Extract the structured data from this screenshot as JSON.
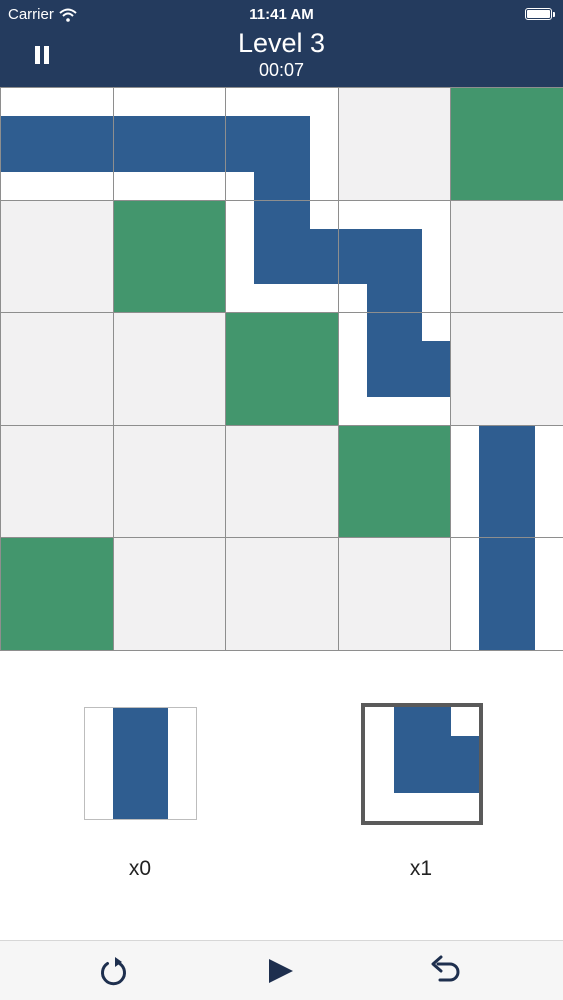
{
  "status_bar": {
    "carrier": "Carrier",
    "time": "11:41 AM"
  },
  "header": {
    "title": "Level 3",
    "timer": "00:07"
  },
  "colors": {
    "header": "#243b5e",
    "pipe": "#2f5d90",
    "block": "#43966d",
    "empty_cell": "#f2f1f2"
  },
  "board": {
    "rows": 5,
    "cols": 5,
    "cells": [
      [
        "horizontal-pipe",
        "horizontal-pipe",
        "corner-west-south",
        "empty",
        "block"
      ],
      [
        "empty",
        "block",
        "corner-north-east",
        "corner-west-south",
        "empty"
      ],
      [
        "empty",
        "empty",
        "block",
        "corner-north-east",
        "empty"
      ],
      [
        "empty",
        "empty",
        "empty",
        "block",
        "vertical-pipe"
      ],
      [
        "block",
        "empty",
        "empty",
        "empty",
        "vertical-pipe"
      ]
    ]
  },
  "palette": [
    {
      "piece": "vertical-pipe",
      "count": "x0",
      "selected": false
    },
    {
      "piece": "corner-north-east",
      "count": "x1",
      "selected": true
    }
  ],
  "toolbar": {
    "icons": [
      "reset-icon",
      "play-icon",
      "undo-icon"
    ]
  }
}
